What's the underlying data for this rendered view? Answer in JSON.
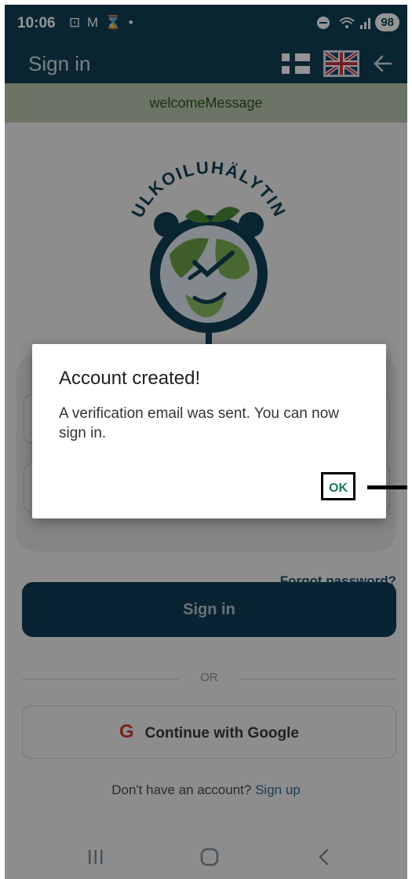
{
  "status_bar": {
    "time": "10:06",
    "notification_icons": "⊡ M ⌛ •",
    "battery": "98"
  },
  "app_bar": {
    "title": "Sign in"
  },
  "banner": {
    "text": "welcomeMessage"
  },
  "logo": {
    "arc_text": "ULKOILUHÄLYTIN"
  },
  "form": {
    "forgot_password": "Forgot password?",
    "signin_label": "Sign in",
    "or_label": "OR",
    "google_g": "G",
    "google_label": "Continue with Google",
    "no_account": "Don't have an account?",
    "signup_link": "Sign up"
  },
  "dialog": {
    "title": "Account created!",
    "message": "A verification email was sent. You can now sign in.",
    "ok_label": "OK"
  },
  "colors": {
    "app_bar": "#124056",
    "banner": "#b9c8ae",
    "primary_button": "#0e3e57",
    "link": "#2a6d93",
    "ok_text": "#1e7b62"
  },
  "icons": [
    "fi-flag-icon",
    "uk-flag-icon",
    "back-arrow-icon",
    "google-g-icon",
    "nav-recents-icon",
    "nav-home-icon",
    "nav-back-icon"
  ]
}
